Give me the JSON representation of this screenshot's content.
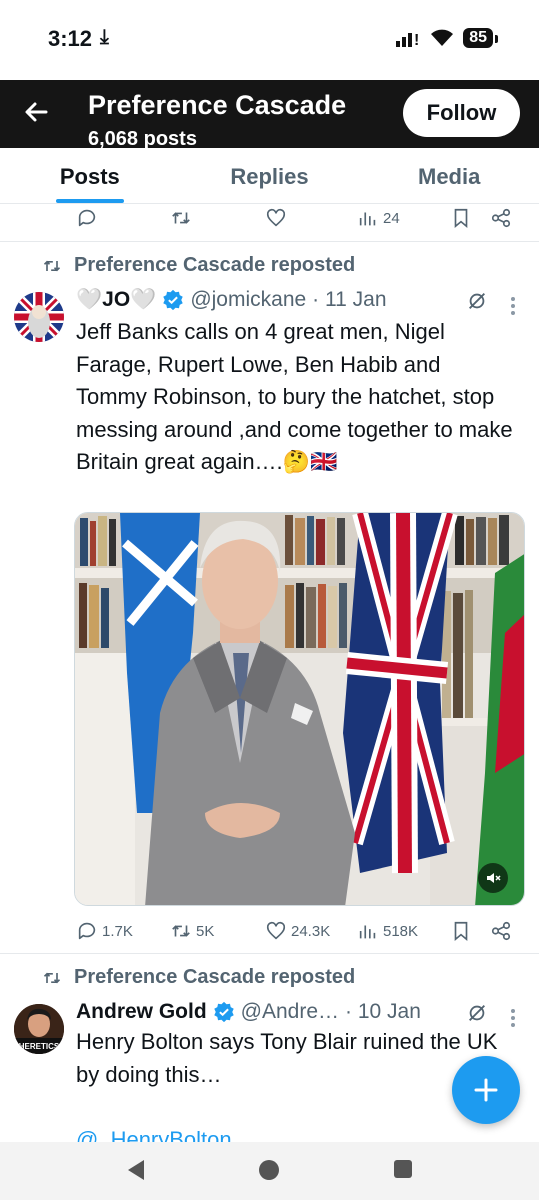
{
  "status_bar": {
    "time": "3:12",
    "download_glyph": "⤓",
    "battery": "85",
    "icons": [
      "signal-icon",
      "wifi-icon",
      "battery-icon"
    ]
  },
  "header": {
    "title": "Preference Cascade",
    "subtitle": "6,068 posts",
    "follow_label": "Follow",
    "back_icon": "arrow-left-icon"
  },
  "tabs": [
    {
      "label": "Posts",
      "active": true
    },
    {
      "label": "Replies",
      "active": false
    },
    {
      "label": "Media",
      "active": false
    }
  ],
  "top_actions": {
    "views": "24"
  },
  "posts": [
    {
      "repost_label": "Preference Cascade reposted",
      "name": "🤍JO🤍",
      "handle": "@jomickane",
      "time": "· 11 Jan",
      "text": "Jeff Banks calls on 4 great men, Nigel Farage, Rupert Lowe, Ben Habib and Tommy Robinson, to bury the hatchet, stop messing around ,and come together to make Britain great again….🤔🇬🇧",
      "stats": {
        "replies": "1.7K",
        "reposts": "5K",
        "likes": "24.3K",
        "views": "518K"
      }
    },
    {
      "repost_label": "Preference Cascade reposted",
      "name": "Andrew Gold",
      "handle": "@Andre…",
      "time": "· 10 Jan",
      "avatar_text": "HERETICS",
      "text": "Henry Bolton says Tony Blair ruined the UK by doing this…",
      "mention": "@_HenryBolton"
    }
  ],
  "colors": {
    "accent": "#1d9bf0",
    "header_bg": "#151515",
    "muted": "#536471"
  },
  "fab_icon": "plus-icon"
}
